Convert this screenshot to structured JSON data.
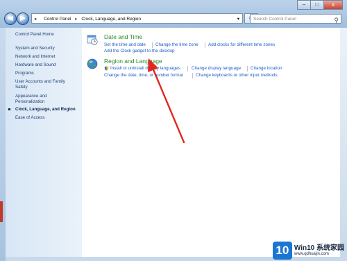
{
  "window": {
    "minimize_glyph": "–",
    "maximize_glyph": "□",
    "close_glyph": "x"
  },
  "nav": {
    "back_glyph": "◀",
    "forward_glyph": "▶"
  },
  "address": {
    "root_glyph": "▸",
    "breadcrumb": [
      "Control Panel",
      "Clock, Language, and Region"
    ],
    "dropdown_glyph": "▾",
    "refresh_glyph": "↻"
  },
  "search": {
    "placeholder": "Search Control Panel"
  },
  "sidebar": {
    "items": [
      {
        "label": "Control Panel Home"
      },
      {
        "label": "System and Security"
      },
      {
        "label": "Network and Internet"
      },
      {
        "label": "Hardware and Sound"
      },
      {
        "label": "Programs"
      },
      {
        "label": "User Accounts and Family Safety"
      },
      {
        "label": "Appearance and Personalization"
      },
      {
        "label": "Clock, Language, and Region",
        "current": true
      },
      {
        "label": "Ease of Access"
      }
    ]
  },
  "main": {
    "date_time": {
      "title": "Date and Time",
      "links": [
        "Set the time and date",
        "Change the time zone",
        "Add clocks for different time zones",
        "Add the Clock gadget to the desktop"
      ]
    },
    "region_language": {
      "title": "Region and Language",
      "links": [
        "Install or uninstall display languages",
        "Change display language",
        "Change location",
        "Change the date, time, or number format",
        "Change keyboards or other input methods"
      ]
    }
  },
  "watermark": {
    "logo": "10",
    "text": "Win10 系统家园",
    "url": "www.qdhuajin.com"
  }
}
